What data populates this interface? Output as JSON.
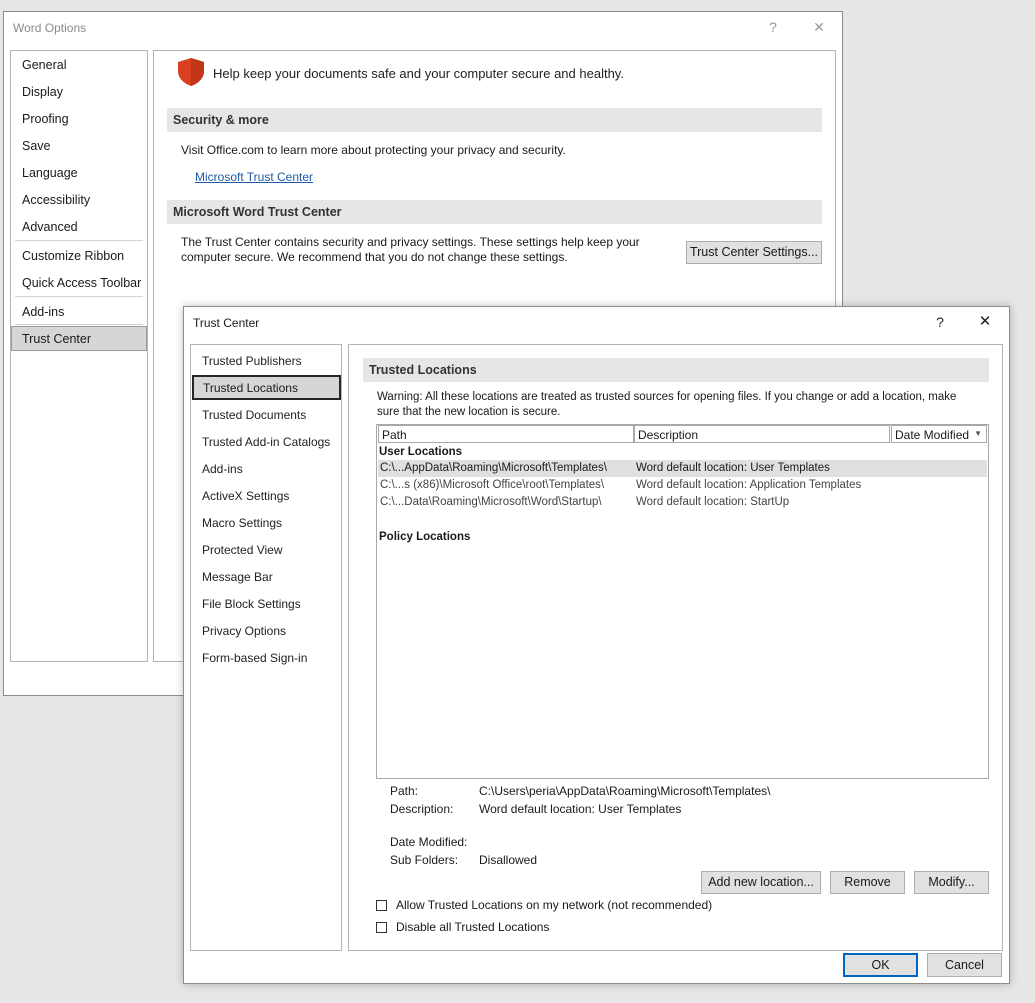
{
  "word_options": {
    "title": "Word Options",
    "help_glyph": "?",
    "close_glyph": "✕",
    "nav": [
      "General",
      "Display",
      "Proofing",
      "Save",
      "Language",
      "Accessibility",
      "Advanced",
      "Customize Ribbon",
      "Quick Access Toolbar",
      "Add-ins",
      "Trust Center"
    ],
    "selected_nav": "Trust Center",
    "banner": "Help keep your documents safe and your computer secure and healthy.",
    "security_header": "Security & more",
    "security_text": "Visit Office.com to learn more about protecting your privacy and security.",
    "trust_link": "Microsoft Trust Center",
    "tc_header": "Microsoft Word Trust Center",
    "tc_text_1": "The Trust Center contains security and privacy settings. These settings help keep your",
    "tc_text_2": "computer secure. We recommend that you do not change these settings.",
    "tc_button": "Trust Center Settings..."
  },
  "trust_center": {
    "title": "Trust Center",
    "help_glyph": "?",
    "close_glyph": "✕",
    "nav": [
      "Trusted Publishers",
      "Trusted Locations",
      "Trusted Documents",
      "Trusted Add-in Catalogs",
      "Add-ins",
      "ActiveX Settings",
      "Macro Settings",
      "Protected View",
      "Message Bar",
      "File Block Settings",
      "Privacy Options",
      "Form-based Sign-in"
    ],
    "selected_nav": "Trusted Locations",
    "section_header": "Trusted Locations",
    "warning_1": "Warning: All these locations are treated as trusted sources for opening files.  If you change or add a location, make",
    "warning_2": "sure that the new location is secure.",
    "columns": {
      "path": "Path",
      "description": "Description",
      "date": "Date Modified"
    },
    "sort_glyph": "▼",
    "user_group": "User Locations",
    "rows": [
      {
        "path": "C:\\...AppData\\Roaming\\Microsoft\\Templates\\",
        "description": "Word default location: User Templates"
      },
      {
        "path": "C:\\...s (x86)\\Microsoft Office\\root\\Templates\\",
        "description": "Word default location: Application Templates"
      },
      {
        "path": "C:\\...Data\\Roaming\\Microsoft\\Word\\Startup\\",
        "description": "Word default location: StartUp"
      }
    ],
    "policy_group": "Policy Locations",
    "details": {
      "path_label": "Path:",
      "path_value": "C:\\Users\\peria\\AppData\\Roaming\\Microsoft\\Templates\\",
      "desc_label": "Description:",
      "desc_value": "Word default location: User Templates",
      "date_label": "Date Modified:",
      "date_value": "",
      "sub_label": "Sub Folders:",
      "sub_value": "Disallowed"
    },
    "buttons": {
      "add": "Add new location...",
      "remove": "Remove",
      "modify": "Modify..."
    },
    "checkbox_network": "Allow Trusted Locations on my network (not recommended)",
    "checkbox_disable": "Disable all Trusted Locations",
    "ok": "OK",
    "cancel": "Cancel"
  },
  "colors": {
    "selected_bg": "#d6d6d6",
    "link": "#1f5aa6",
    "shield": "#d9401f",
    "row_selected": "#e0e0e0",
    "default_button_border": "#0067c0"
  },
  "icons": {
    "shield": "shield-icon",
    "close": "close-icon",
    "help": "help-icon"
  }
}
